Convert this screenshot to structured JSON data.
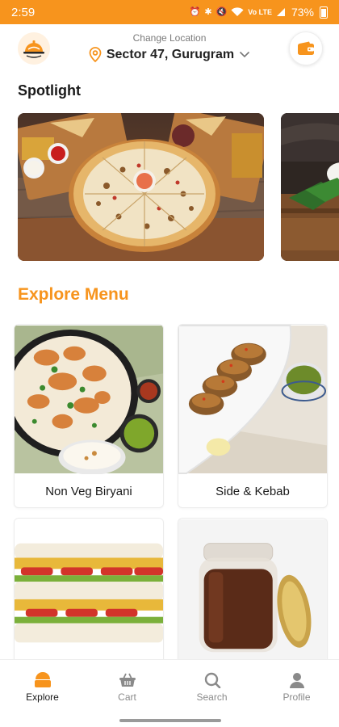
{
  "status_bar": {
    "time": "2:59",
    "battery": "73%"
  },
  "header": {
    "location_caption": "Change Location",
    "location_name": "Sector 47, Gurugram"
  },
  "spotlight": {
    "title": "Spotlight",
    "banners": [
      {
        "icon": "pizza-platter-image"
      },
      {
        "icon": "dessert-image"
      }
    ]
  },
  "explore": {
    "title": "Explore Menu",
    "items": [
      {
        "label": "Non Veg Biryani",
        "icon": "biryani-image"
      },
      {
        "label": "Side & Kebab",
        "icon": "kebab-image"
      },
      {
        "label": "",
        "icon": "sandwich-image"
      },
      {
        "label": "",
        "icon": "sauce-jar-image"
      }
    ]
  },
  "nav": {
    "items": [
      {
        "label": "Explore",
        "icon": "explore-icon",
        "active": true
      },
      {
        "label": "Cart",
        "icon": "cart-icon",
        "active": false
      },
      {
        "label": "Search",
        "icon": "search-icon",
        "active": false
      },
      {
        "label": "Profile",
        "icon": "profile-icon",
        "active": false
      }
    ]
  },
  "colors": {
    "accent": "#F7941D",
    "text": "#1a1a1a",
    "muted": "#8a8a8a"
  }
}
